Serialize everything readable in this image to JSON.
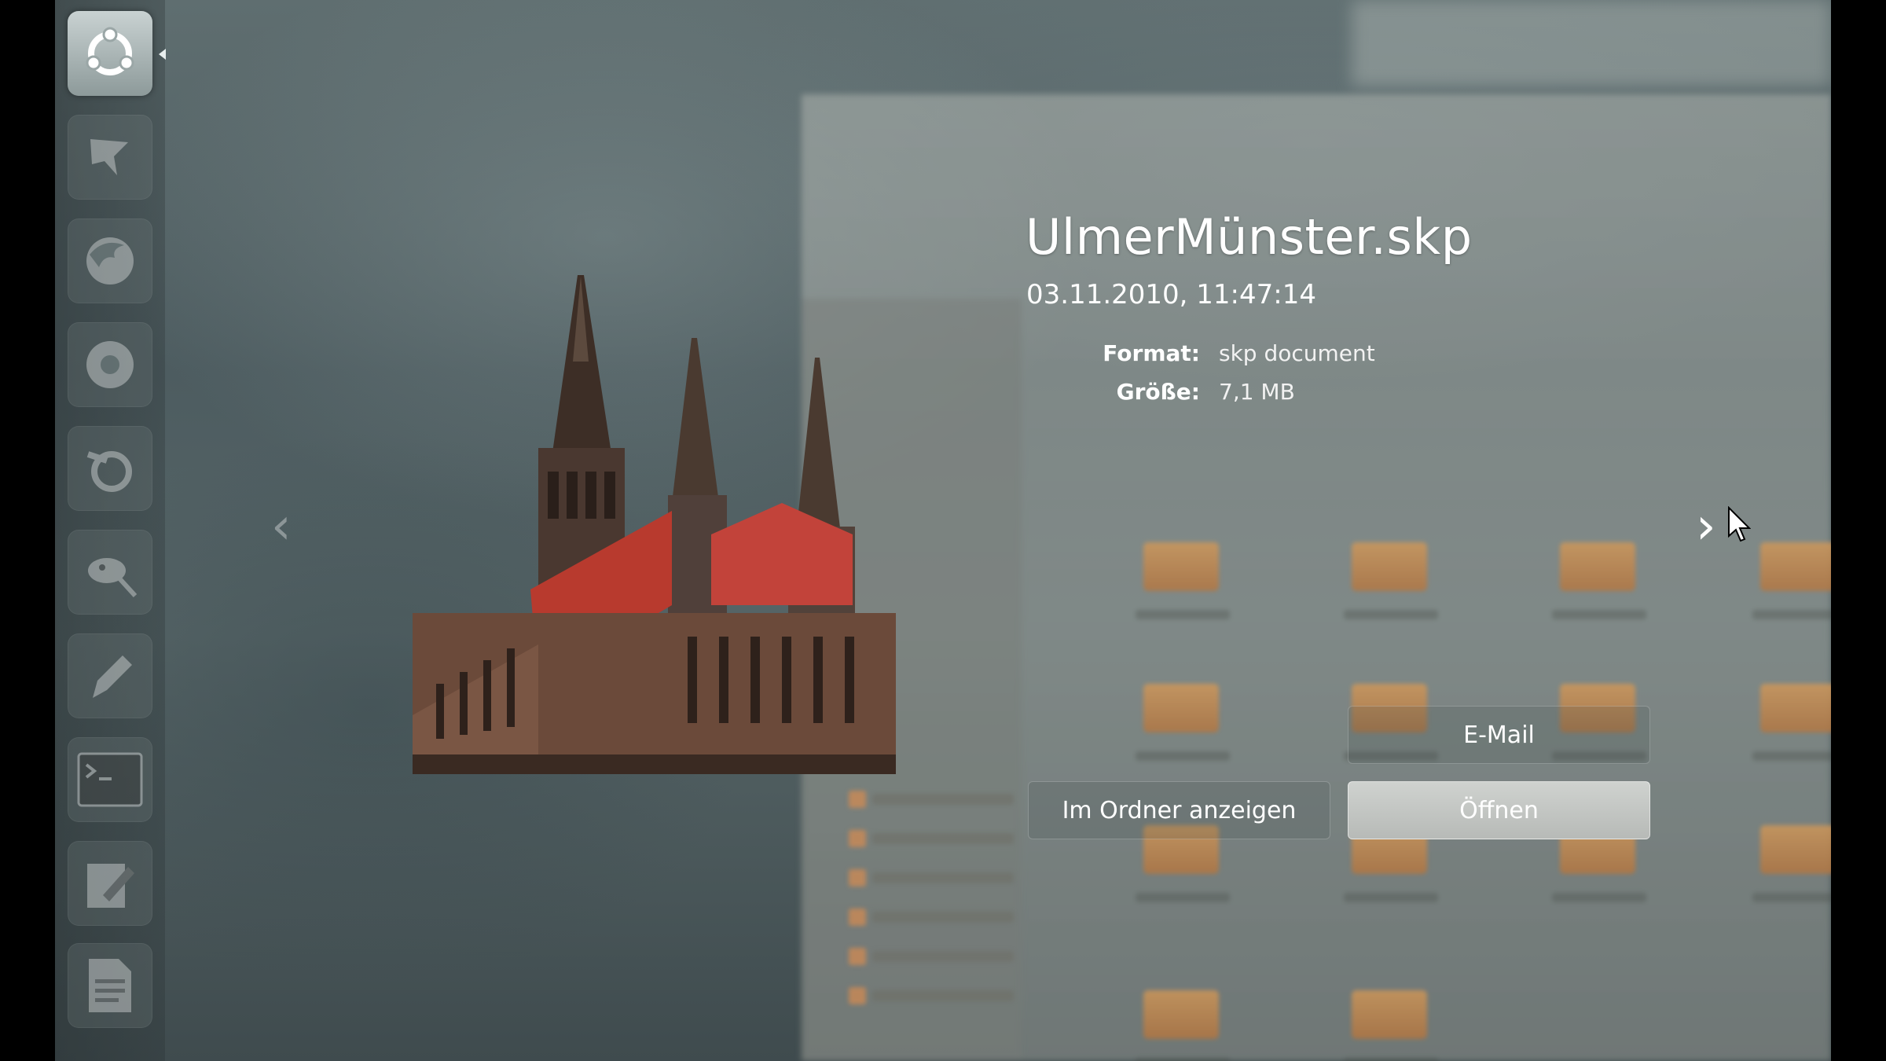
{
  "preview": {
    "title": "UlmerMünster.skp",
    "date": "03.11.2010, 11:47:14",
    "meta": [
      {
        "label": "Format:",
        "value": "skp document"
      },
      {
        "label": "Größe:",
        "value": "7,1 MB"
      }
    ],
    "prev_arrow": "‹",
    "next_arrow": "›"
  },
  "actions": {
    "email_label": "E-Mail",
    "show_in_folder_label": "Im Ordner anzeigen",
    "open_label": "Öffnen"
  },
  "launcher": {
    "items": [
      {
        "icon": "dash-home-icon",
        "active": true
      },
      {
        "icon": "inkscape-icon"
      },
      {
        "icon": "firefox-icon"
      },
      {
        "icon": "chromium-icon"
      },
      {
        "icon": "blender-icon"
      },
      {
        "icon": "gimp-icon"
      },
      {
        "icon": "pen-tool-icon"
      },
      {
        "icon": "terminal-icon"
      },
      {
        "icon": "text-editor-icon"
      },
      {
        "icon": "document-viewer-icon"
      }
    ]
  },
  "colors": {
    "accent_button": "#c3c6c3",
    "text": "#ffffff",
    "roof_red": "#b83a2e",
    "stone": "#6b4a3a"
  }
}
